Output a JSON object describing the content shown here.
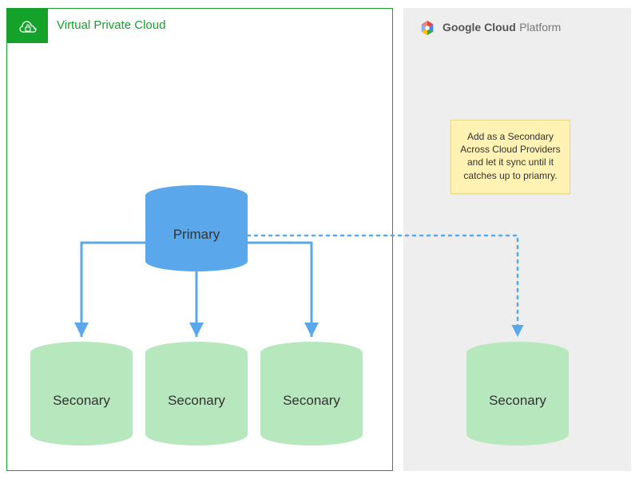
{
  "vpc": {
    "title": "Virtual Private Cloud"
  },
  "gcp": {
    "brand": "Google Cloud",
    "product": "Platform"
  },
  "nodes": {
    "primary": {
      "label": "Primary"
    },
    "sec1": {
      "label": "Seconary"
    },
    "sec2": {
      "label": "Seconary"
    },
    "sec3": {
      "label": "Seconary"
    },
    "sec4": {
      "label": "Seconary"
    }
  },
  "note": "Add as a Secondary Across Cloud Providers and let it sync until it catches up to priamry.",
  "colors": {
    "vpc_border": "#15a22a",
    "primary_fill": "#5aa8eb",
    "secondary_fill": "#b7e8bd",
    "note_fill": "#fff2b3",
    "gcp_bg": "#eeeeee",
    "arrow": "#5aa8eb"
  }
}
